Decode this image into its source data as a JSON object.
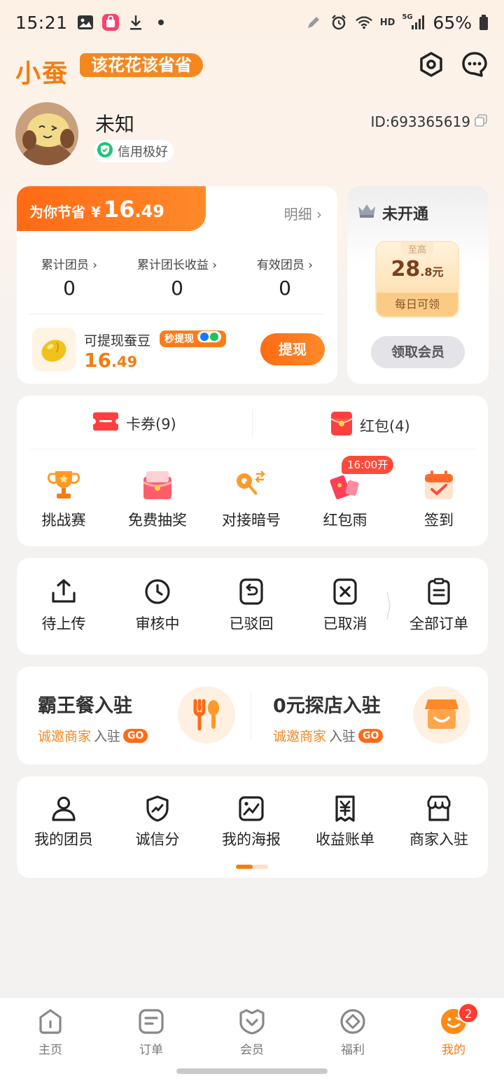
{
  "status_bar": {
    "time": "15:21",
    "battery": "65%",
    "network_label": "HD",
    "signal_label": "5G"
  },
  "header": {
    "logo": "小蚕",
    "slogan": "该花花该省省"
  },
  "profile": {
    "nickname": "未知",
    "credit": "信用极好",
    "id_text": "ID:693365619"
  },
  "savings": {
    "label": "为你节省",
    "currency": "¥",
    "amount_int": "16",
    "amount_dec": ".49",
    "detail": "明细 ›",
    "stats": [
      {
        "title": "累计团员 ›",
        "value": "0"
      },
      {
        "title": "累计团长收益 ›",
        "value": "0"
      },
      {
        "title": "有效团员 ›",
        "value": "0"
      }
    ],
    "withdraw_label": "可提现蚕豆",
    "instant_tag": "秒提现",
    "bean_int": "16",
    "bean_dec": ".49",
    "withdraw_button": "提现"
  },
  "vip": {
    "status": "未开通",
    "ticket_top": "至高",
    "ticket_int": "28",
    "ticket_dec": ".8",
    "ticket_unit": "元",
    "ticket_daily": "每日可领",
    "button": "领取会员"
  },
  "coupons": {
    "cards": "卡券(9)",
    "redpacks": "红包(4)",
    "timer_badge": "16:00开",
    "grid": [
      {
        "label": "挑战赛"
      },
      {
        "label": "免费抽奖"
      },
      {
        "label": "对接暗号"
      },
      {
        "label": "红包雨"
      },
      {
        "label": "签到"
      }
    ]
  },
  "orders": [
    {
      "label": "待上传"
    },
    {
      "label": "审核中"
    },
    {
      "label": "已驳回"
    },
    {
      "label": "已取消"
    },
    {
      "label": "全部订单"
    }
  ],
  "merchant": {
    "left": {
      "title": "霸王餐入驻",
      "sub_a": "诚邀商家",
      "sub_b": "入驻",
      "go": "GO"
    },
    "right": {
      "title": "0元探店入驻",
      "sub_a": "诚邀商家",
      "sub_b": "入驻",
      "go": "GO"
    }
  },
  "tools": [
    {
      "label": "我的团员"
    },
    {
      "label": "诚信分"
    },
    {
      "label": "我的海报"
    },
    {
      "label": "收益账单"
    },
    {
      "label": "商家入驻"
    }
  ],
  "bottom_nav": {
    "items": [
      {
        "label": "主页"
      },
      {
        "label": "订单"
      },
      {
        "label": "会员"
      },
      {
        "label": "福利"
      },
      {
        "label": "我的"
      }
    ],
    "badge": "2"
  },
  "colors": {
    "accent": "#f47d12",
    "accent_light": "#ff8a2a",
    "red": "#ff3b30"
  }
}
